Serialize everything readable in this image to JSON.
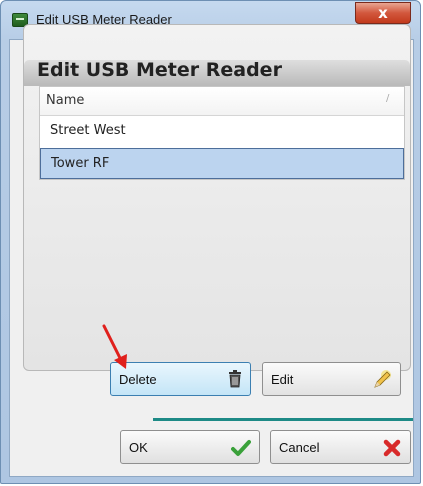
{
  "window": {
    "title": "Edit USB Meter Reader",
    "close_glyph": "x"
  },
  "panel": {
    "title": "Edit USB Meter Reader",
    "column_header": "Name",
    "sort_glyph": "/",
    "rows": [
      {
        "label": "Street West",
        "selected": false
      },
      {
        "label": "Tower RF",
        "selected": true
      }
    ]
  },
  "actions": {
    "delete_label": "Delete",
    "delete_icon": "trash-icon",
    "edit_label": "Edit",
    "edit_icon": "pencil-icon"
  },
  "dialog_buttons": {
    "ok_label": "OK",
    "ok_icon": "checkmark-icon",
    "cancel_label": "Cancel",
    "cancel_icon": "red-x-icon"
  },
  "annotation": {
    "arrow_color": "#e0201c",
    "points_to": "Delete"
  },
  "colors": {
    "selection": "#bcd4ef",
    "accent_line": "#1d8a86"
  }
}
